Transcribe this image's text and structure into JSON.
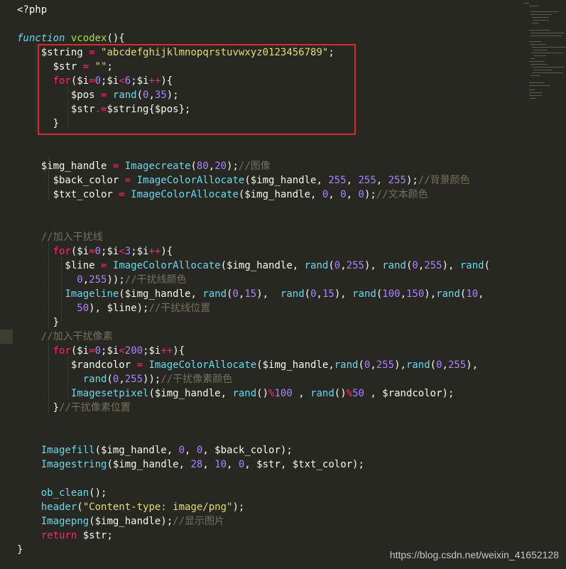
{
  "editor": {
    "theme_colors": {
      "background": "#272822",
      "keyword": "#f92672",
      "function": "#66d9ef",
      "string": "#e6db74",
      "number": "#ae81ff",
      "comment": "#75715e",
      "highlight_box": "#e0262f"
    },
    "lines": [
      {
        "tokens": [
          [
            "tag",
            "<?php"
          ]
        ]
      },
      {
        "tokens": []
      },
      {
        "tokens": [
          [
            "fn",
            "function"
          ],
          [
            "var",
            " "
          ],
          [
            "def",
            "vcodex"
          ],
          [
            "var",
            "(){"
          ]
        ]
      },
      {
        "tokens": [
          [
            "var",
            "    $string "
          ],
          [
            "op",
            "="
          ],
          [
            "var",
            " "
          ],
          [
            "str",
            "\"abcdefghijklmnopqrstuvwxyz0123456789\""
          ],
          [
            "var",
            ";"
          ]
        ]
      },
      {
        "tokens": [
          [
            "var",
            "      $str "
          ],
          [
            "op",
            "="
          ],
          [
            "var",
            " "
          ],
          [
            "str",
            "\"\""
          ],
          [
            "var",
            ";"
          ]
        ]
      },
      {
        "tokens": [
          [
            "var",
            "      "
          ],
          [
            "kw",
            "for"
          ],
          [
            "var",
            "($i"
          ],
          [
            "op",
            "="
          ],
          [
            "num",
            "0"
          ],
          [
            "var",
            ";$i"
          ],
          [
            "op",
            "<"
          ],
          [
            "num",
            "6"
          ],
          [
            "var",
            ";$i"
          ],
          [
            "op",
            "++"
          ],
          [
            "var",
            "){"
          ]
        ]
      },
      {
        "tokens": [
          [
            "var",
            "         $pos "
          ],
          [
            "op",
            "="
          ],
          [
            "var",
            " "
          ],
          [
            "call",
            "rand"
          ],
          [
            "var",
            "("
          ],
          [
            "num",
            "0"
          ],
          [
            "var",
            ","
          ],
          [
            "num",
            "35"
          ],
          [
            "var",
            ");"
          ]
        ]
      },
      {
        "tokens": [
          [
            "var",
            "         $str"
          ],
          [
            "op",
            ".="
          ],
          [
            "var",
            "$string{$pos};"
          ]
        ]
      },
      {
        "tokens": [
          [
            "var",
            "      }"
          ]
        ]
      },
      {
        "tokens": []
      },
      {
        "tokens": []
      },
      {
        "tokens": [
          [
            "var",
            "    $img_handle "
          ],
          [
            "op",
            "="
          ],
          [
            "var",
            " "
          ],
          [
            "call",
            "Imagecreate"
          ],
          [
            "var",
            "("
          ],
          [
            "num",
            "80"
          ],
          [
            "var",
            ","
          ],
          [
            "num",
            "20"
          ],
          [
            "var",
            ");"
          ],
          [
            "cm",
            "//图像"
          ]
        ]
      },
      {
        "tokens": [
          [
            "var",
            "      $back_color "
          ],
          [
            "op",
            "="
          ],
          [
            "var",
            " "
          ],
          [
            "call",
            "ImageColorAllocate"
          ],
          [
            "var",
            "($img_handle, "
          ],
          [
            "num",
            "255"
          ],
          [
            "var",
            ", "
          ],
          [
            "num",
            "255"
          ],
          [
            "var",
            ", "
          ],
          [
            "num",
            "255"
          ],
          [
            "var",
            ");"
          ],
          [
            "cm",
            "//背景颜色"
          ]
        ]
      },
      {
        "tokens": [
          [
            "var",
            "      $txt_color "
          ],
          [
            "op",
            "="
          ],
          [
            "var",
            " "
          ],
          [
            "call",
            "ImageColorAllocate"
          ],
          [
            "var",
            "($img_handle, "
          ],
          [
            "num",
            "0"
          ],
          [
            "var",
            ", "
          ],
          [
            "num",
            "0"
          ],
          [
            "var",
            ", "
          ],
          [
            "num",
            "0"
          ],
          [
            "var",
            ");"
          ],
          [
            "cm",
            "//文本颜色"
          ]
        ]
      },
      {
        "tokens": []
      },
      {
        "tokens": []
      },
      {
        "tokens": [
          [
            "cm",
            "    //加入干扰线"
          ]
        ]
      },
      {
        "tokens": [
          [
            "var",
            "      "
          ],
          [
            "kw",
            "for"
          ],
          [
            "var",
            "($i"
          ],
          [
            "op",
            "="
          ],
          [
            "num",
            "0"
          ],
          [
            "var",
            ";$i"
          ],
          [
            "op",
            "<"
          ],
          [
            "num",
            "3"
          ],
          [
            "var",
            ";$i"
          ],
          [
            "op",
            "++"
          ],
          [
            "var",
            "){"
          ]
        ]
      },
      {
        "tokens": [
          [
            "var",
            "        $line "
          ],
          [
            "op",
            "="
          ],
          [
            "var",
            " "
          ],
          [
            "call",
            "ImageColorAllocate"
          ],
          [
            "var",
            "($img_handle, "
          ],
          [
            "call",
            "rand"
          ],
          [
            "var",
            "("
          ],
          [
            "num",
            "0"
          ],
          [
            "var",
            ","
          ],
          [
            "num",
            "255"
          ],
          [
            "var",
            "), "
          ],
          [
            "call",
            "rand"
          ],
          [
            "var",
            "("
          ],
          [
            "num",
            "0"
          ],
          [
            "var",
            ","
          ],
          [
            "num",
            "255"
          ],
          [
            "var",
            "), "
          ],
          [
            "call",
            "rand"
          ],
          [
            "var",
            "("
          ]
        ]
      },
      {
        "tokens": [
          [
            "var",
            "          "
          ],
          [
            "num",
            "0"
          ],
          [
            "var",
            ","
          ],
          [
            "num",
            "255"
          ],
          [
            "var",
            "));"
          ],
          [
            "cm",
            "//干扰线颜色"
          ]
        ]
      },
      {
        "tokens": [
          [
            "var",
            "        "
          ],
          [
            "call",
            "Imageline"
          ],
          [
            "var",
            "($img_handle, "
          ],
          [
            "call",
            "rand"
          ],
          [
            "var",
            "("
          ],
          [
            "num",
            "0"
          ],
          [
            "var",
            ","
          ],
          [
            "num",
            "15"
          ],
          [
            "var",
            "),  "
          ],
          [
            "call",
            "rand"
          ],
          [
            "var",
            "("
          ],
          [
            "num",
            "0"
          ],
          [
            "var",
            ","
          ],
          [
            "num",
            "15"
          ],
          [
            "var",
            "), "
          ],
          [
            "call",
            "rand"
          ],
          [
            "var",
            "("
          ],
          [
            "num",
            "100"
          ],
          [
            "var",
            ","
          ],
          [
            "num",
            "150"
          ],
          [
            "var",
            "),"
          ],
          [
            "call",
            "rand"
          ],
          [
            "var",
            "("
          ],
          [
            "num",
            "10"
          ],
          [
            "var",
            ","
          ]
        ]
      },
      {
        "tokens": [
          [
            "var",
            "          "
          ],
          [
            "num",
            "50"
          ],
          [
            "var",
            "), $line);"
          ],
          [
            "cm",
            "//干扰线位置"
          ]
        ]
      },
      {
        "tokens": [
          [
            "var",
            "      }"
          ]
        ]
      },
      {
        "tokens": [
          [
            "cm",
            "    //加入干扰像素"
          ]
        ]
      },
      {
        "tokens": [
          [
            "var",
            "      "
          ],
          [
            "kw",
            "for"
          ],
          [
            "var",
            "($i"
          ],
          [
            "op",
            "="
          ],
          [
            "num",
            "0"
          ],
          [
            "var",
            ";$i"
          ],
          [
            "op",
            "<"
          ],
          [
            "num",
            "200"
          ],
          [
            "var",
            ";$i"
          ],
          [
            "op",
            "++"
          ],
          [
            "var",
            "){"
          ]
        ]
      },
      {
        "tokens": [
          [
            "var",
            "         $randcolor "
          ],
          [
            "op",
            "="
          ],
          [
            "var",
            " "
          ],
          [
            "call",
            "ImageColorAllocate"
          ],
          [
            "var",
            "($img_handle,"
          ],
          [
            "call",
            "rand"
          ],
          [
            "var",
            "("
          ],
          [
            "num",
            "0"
          ],
          [
            "var",
            ","
          ],
          [
            "num",
            "255"
          ],
          [
            "var",
            "),"
          ],
          [
            "call",
            "rand"
          ],
          [
            "var",
            "("
          ],
          [
            "num",
            "0"
          ],
          [
            "var",
            ","
          ],
          [
            "num",
            "255"
          ],
          [
            "var",
            "),"
          ]
        ]
      },
      {
        "tokens": [
          [
            "var",
            "           "
          ],
          [
            "call",
            "rand"
          ],
          [
            "var",
            "("
          ],
          [
            "num",
            "0"
          ],
          [
            "var",
            ","
          ],
          [
            "num",
            "255"
          ],
          [
            "var",
            "));"
          ],
          [
            "cm",
            "//干扰像素颜色"
          ]
        ]
      },
      {
        "tokens": [
          [
            "var",
            "         "
          ],
          [
            "call",
            "Imagesetpixel"
          ],
          [
            "var",
            "($img_handle, "
          ],
          [
            "call",
            "rand"
          ],
          [
            "var",
            "()"
          ],
          [
            "op",
            "%"
          ],
          [
            "num",
            "100"
          ],
          [
            "var",
            " , "
          ],
          [
            "call",
            "rand"
          ],
          [
            "var",
            "()"
          ],
          [
            "op",
            "%"
          ],
          [
            "num",
            "50"
          ],
          [
            "var",
            " , $randcolor);"
          ]
        ]
      },
      {
        "tokens": [
          [
            "var",
            "      }"
          ],
          [
            "cm",
            "//干扰像素位置"
          ]
        ]
      },
      {
        "tokens": []
      },
      {
        "tokens": []
      },
      {
        "tokens": [
          [
            "call",
            "    Imagefill"
          ],
          [
            "var",
            "($img_handle, "
          ],
          [
            "num",
            "0"
          ],
          [
            "var",
            ", "
          ],
          [
            "num",
            "0"
          ],
          [
            "var",
            ", $back_color);"
          ]
        ]
      },
      {
        "tokens": [
          [
            "call",
            "    Imagestring"
          ],
          [
            "var",
            "($img_handle, "
          ],
          [
            "num",
            "28"
          ],
          [
            "var",
            ", "
          ],
          [
            "num",
            "10"
          ],
          [
            "var",
            ", "
          ],
          [
            "num",
            "0"
          ],
          [
            "var",
            ", $str, $txt_color);"
          ]
        ]
      },
      {
        "tokens": []
      },
      {
        "tokens": [
          [
            "call",
            "    ob_clean"
          ],
          [
            "var",
            "();"
          ]
        ]
      },
      {
        "tokens": [
          [
            "call",
            "    header"
          ],
          [
            "var",
            "("
          ],
          [
            "str",
            "\"Content-type: image/png\""
          ],
          [
            "var",
            ");"
          ]
        ]
      },
      {
        "tokens": [
          [
            "call",
            "    Imagepng"
          ],
          [
            "var",
            "($img_handle);"
          ],
          [
            "cm",
            "//显示图片"
          ]
        ]
      },
      {
        "tokens": [
          [
            "kw",
            "    return"
          ],
          [
            "var",
            " $str;"
          ]
        ]
      },
      {
        "tokens": [
          [
            "var",
            "}"
          ]
        ]
      }
    ]
  },
  "watermark": "https://blog.csdn.net/weixin_41652128"
}
